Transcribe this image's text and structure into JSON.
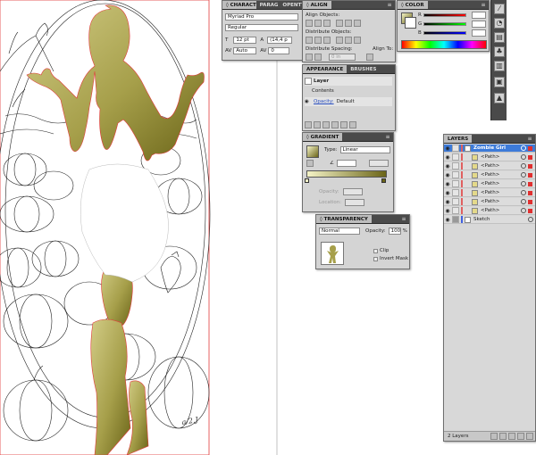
{
  "character_panel": {
    "tabs": [
      "◊ CHARACTER",
      "PARAGR",
      "OPENTY"
    ],
    "font_family": "Myriad Pro",
    "font_style": "Regular",
    "font_size": "12 pt",
    "leading": "(14,4 p",
    "kerning": "Auto",
    "tracking": "0"
  },
  "align_panel": {
    "tabs": [
      "◊ ALIGN"
    ],
    "align_objects_label": "Align Objects:",
    "distribute_objects_label": "Distribute Objects:",
    "distribute_spacing_label": "Distribute Spacing:",
    "align_to_label": "Align To:",
    "spacing_value": "0 in"
  },
  "color_panel": {
    "tabs": [
      "◊ COLOR"
    ],
    "channels": [
      "R",
      "G",
      "B"
    ]
  },
  "appearance_panel": {
    "tabs": [
      "APPEARANCE",
      "BRUSHES"
    ],
    "layer_label": "Layer",
    "contents_label": "Contents",
    "opacity_label": "Opacity:",
    "opacity_value": "Default"
  },
  "gradient_panel": {
    "tabs": [
      "◊ GRADIENT"
    ],
    "type_label": "Type:",
    "type_value": "Linear",
    "opacity_label": "Opacity:",
    "location_label": "Location:",
    "colors": {
      "start": "#f4f3c6",
      "end": "#6b6518"
    }
  },
  "transparency_panel": {
    "tabs": [
      "◊ TRANSPARENCY"
    ],
    "blend_mode": "Normal",
    "opacity_label": "Opacity:",
    "opacity_value": "100",
    "percent": "%",
    "clip_label": "Clip",
    "invert_mask_label": "Invert Mask"
  },
  "layers_panel": {
    "tabs": [
      "LAYERS"
    ],
    "rows": [
      {
        "name": "Zombie Girl",
        "selected": true
      },
      {
        "name": "<Path>",
        "selected": false
      },
      {
        "name": "<Path>",
        "selected": false
      },
      {
        "name": "<Path>",
        "selected": false
      },
      {
        "name": "<Path>",
        "selected": false
      },
      {
        "name": "<Path>",
        "selected": false
      },
      {
        "name": "<Path>",
        "selected": false
      },
      {
        "name": "<Path>",
        "selected": false
      },
      {
        "name": "Sketch",
        "selected": false
      }
    ],
    "footer_count": "2 Layers"
  },
  "artwork": {
    "signature": "a/2.J",
    "silhouette_colors": {
      "light": "#c8c27a",
      "dark": "#6a6418"
    },
    "guide_color": "#e23a3a"
  },
  "tools": [
    "eyedropper-icon",
    "paint-bucket-icon",
    "gradient-icon",
    "blend-icon",
    "symbol-sprayer-icon",
    "graph-icon",
    "artboard-icon"
  ]
}
